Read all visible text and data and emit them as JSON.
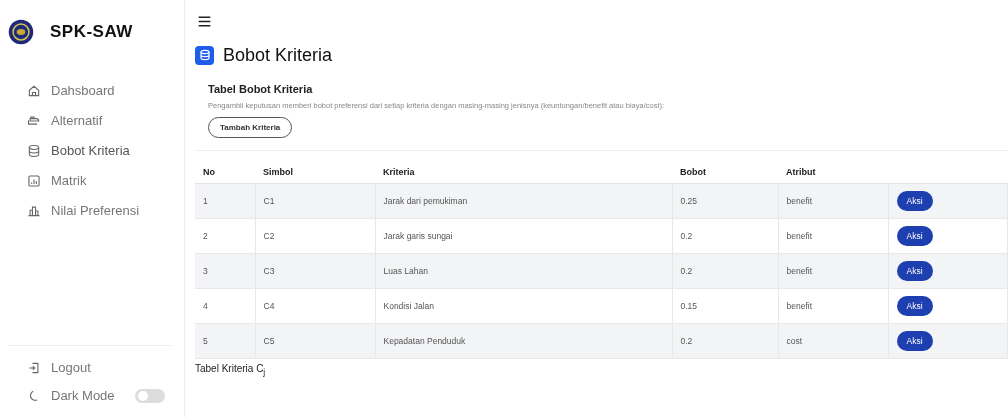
{
  "sidebar": {
    "brand": "SPK-SAW",
    "items": [
      {
        "label": "Dahsboard",
        "selected": false
      },
      {
        "label": "Alternatif",
        "selected": false
      },
      {
        "label": "Bobot Kriteria",
        "selected": true
      },
      {
        "label": "Matrik",
        "selected": false
      },
      {
        "label": "Nilai Preferensi",
        "selected": false
      }
    ],
    "logout": "Logout",
    "dark_mode": {
      "label": "Dark Mode",
      "on": false
    }
  },
  "page": {
    "title": "Bobot Kriteria"
  },
  "card": {
    "title": "Tabel Bobot Kriteria",
    "description": "Pengambil keputusan memberi bobot preferensi dari setiap kriteria dengan masing-masing jenisnya (keuntungan/benefit atau biaya/cost):",
    "add_button": "Tambah Kriteria"
  },
  "table": {
    "columns": [
      "No",
      "Simbol",
      "Kriteria",
      "Bobot",
      "Atribut"
    ],
    "rows": [
      {
        "cells": [
          "1",
          "C1",
          "Jarak dari pemukiman",
          "0.25",
          "benefit"
        ],
        "action": "Aksi"
      },
      {
        "cells": [
          "2",
          "C2",
          "Jarak garis sungai",
          "0.2",
          "benefit"
        ],
        "action": "Aksi"
      },
      {
        "cells": [
          "3",
          "C3",
          "Luas Lahan",
          "0.2",
          "benefit"
        ],
        "action": "Aksi"
      },
      {
        "cells": [
          "4",
          "C4",
          "Kondisi Jalan",
          "0.15",
          "benefit"
        ],
        "action": "Aksi"
      },
      {
        "cells": [
          "5",
          "C5",
          "Kepadatan Penduduk",
          "0.2",
          "cost"
        ],
        "action": "Aksi"
      }
    ]
  },
  "next_section": "Tabel Kriteria C$_{j}$"
}
